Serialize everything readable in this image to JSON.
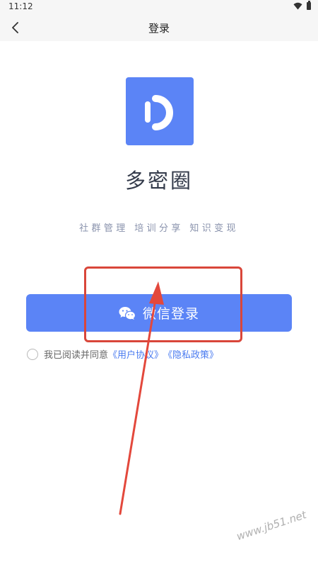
{
  "status_bar": {
    "time": "11:12"
  },
  "app_bar": {
    "title": "登录",
    "back_icon": "chevron-left-icon"
  },
  "logo": {
    "icon": "app-logo-d",
    "color": "#5b84f6"
  },
  "app_name": "多密圈",
  "tagline": "社群管理 培训分享 知识变现",
  "login_button": {
    "label": "微信登录",
    "icon": "wechat-icon",
    "color": "#5b84f6"
  },
  "agreement": {
    "prefix": "我已阅读并同意",
    "user_agreement": "《用户协议》",
    "privacy_policy": "《隐私政策》",
    "link_color": "#4a7bf0"
  },
  "annotation": {
    "box_color": "#d9463a",
    "arrow_color": "#e3483c"
  },
  "watermark": "www.jb51.net"
}
